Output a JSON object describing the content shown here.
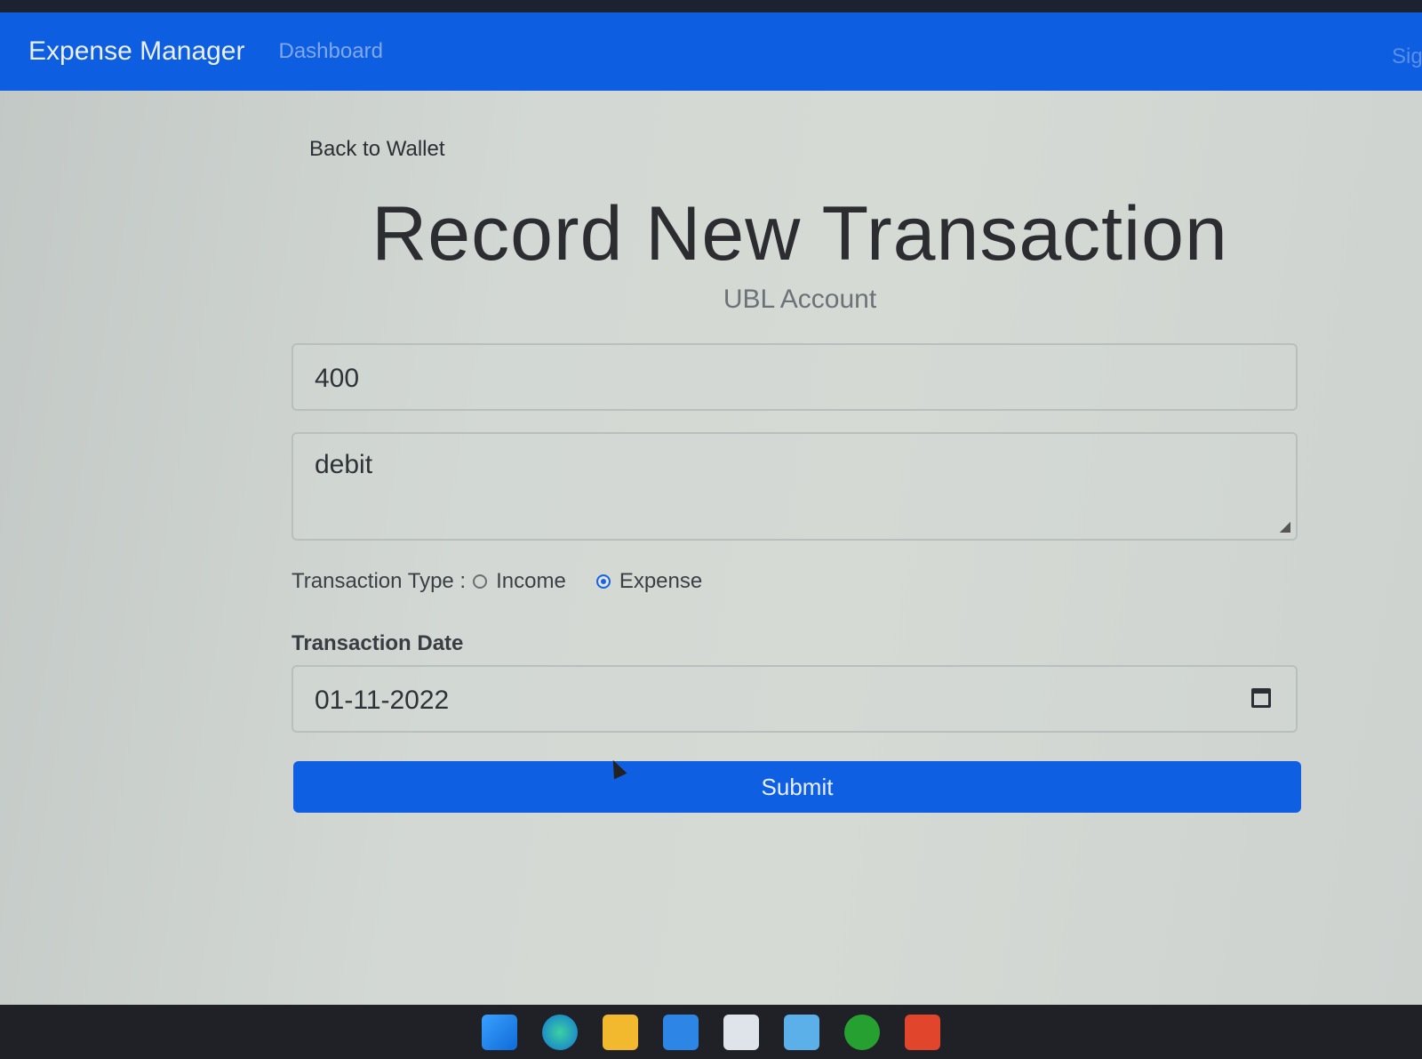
{
  "navbar": {
    "brand": "Expense Manager",
    "dashboard": "Dashboard",
    "right_link": "Sig"
  },
  "page": {
    "back_link": "Back to Wallet",
    "title": "Record New Transaction",
    "subtitle": "UBL Account"
  },
  "form": {
    "amount_value": "400",
    "description_value": "debit",
    "transaction_type_label": "Transaction Type :",
    "types": [
      {
        "label": "Income",
        "checked": false
      },
      {
        "label": "Expense",
        "checked": true
      }
    ],
    "date_label": "Transaction Date",
    "date_value": "01-11-2022",
    "submit_label": "Submit"
  },
  "colors": {
    "primary": "#0d5ee0",
    "background": "#d0d5d2"
  },
  "taskbar_icons": [
    "windows-start-icon",
    "edge-browser-icon",
    "file-explorer-icon",
    "mail-icon",
    "store-icon",
    "app-icon",
    "xbox-icon",
    "brave-browser-icon"
  ]
}
